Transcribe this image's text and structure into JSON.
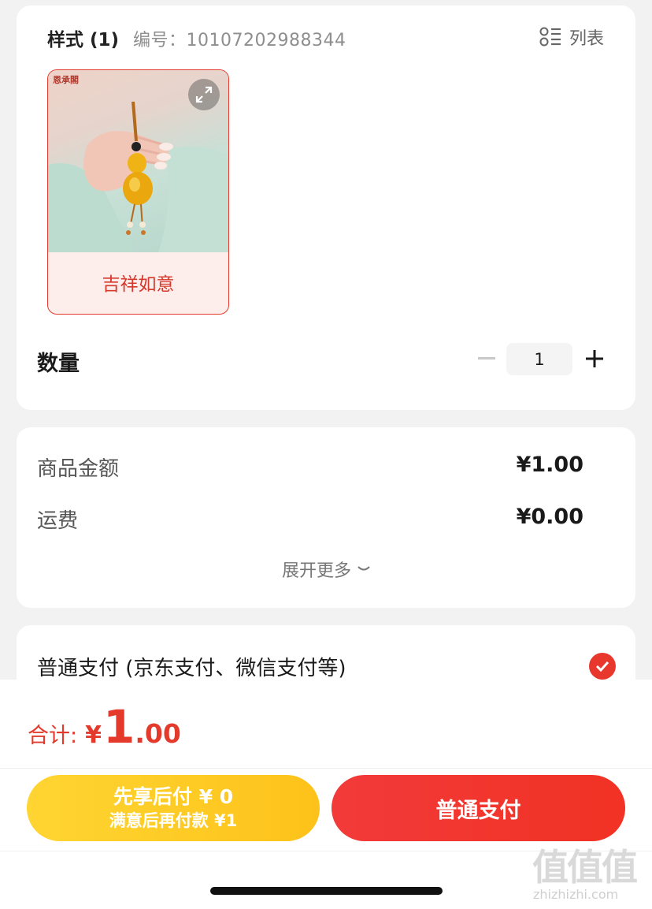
{
  "style_section": {
    "title": "样式 (1)",
    "code_label": "编号：10107202988344",
    "list_toggle_label": "列表",
    "variant": {
      "label": "吉祥如意",
      "brand_mark": "恩承閣",
      "selected": true
    }
  },
  "quantity": {
    "label": "数量",
    "value": "1"
  },
  "amounts": {
    "items": [
      {
        "label": "商品金额",
        "value": "¥1.00"
      },
      {
        "label": "运费",
        "value": "¥0.00"
      }
    ],
    "expand_label": "展开更多"
  },
  "payment": {
    "method_label": "普通支付 (京东支付、微信支付等)",
    "selected": true
  },
  "bottom_bar": {
    "total_label": "合计:",
    "total_currency": "¥",
    "total_integer": "1",
    "total_decimal": ".00",
    "pay_later_main": "先享后付 ¥ 0",
    "pay_later_sub": "满意后再付款 ¥1",
    "pay_now_label": "普通支付"
  },
  "watermark": {
    "text": "值值值",
    "url": "zhizhizhi.com"
  },
  "colors": {
    "accent_red": "#e33a2b",
    "pay_later_yellow": "#fdc21a",
    "card_bg": "#ffffff",
    "page_bg": "#f2f2f2"
  }
}
